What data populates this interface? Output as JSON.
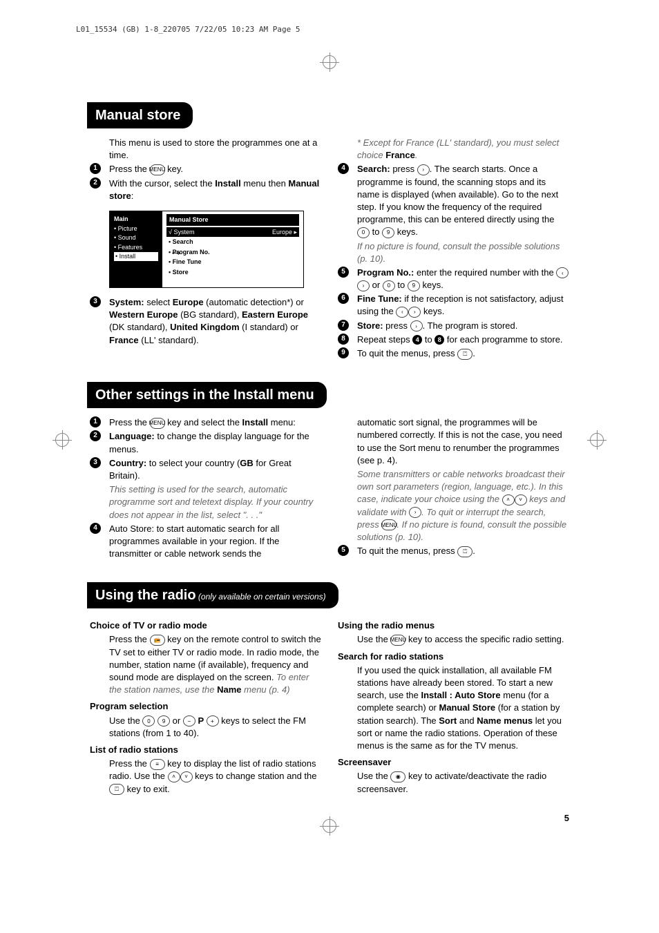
{
  "print_header": "L01_15534 (GB) 1-8_220705  7/22/05  10:23 AM  Page 5",
  "manual_store": {
    "title": "Manual store",
    "intro": "This menu is used to store the programmes one at a time.",
    "step1": "Press the ",
    "step1_key": "MENU",
    "step1_end": " key.",
    "step2a": "With the cursor, select the ",
    "step2b": "Install",
    "step2c": " menu then ",
    "step2d": "Manual store",
    "step2e": ":",
    "menu": {
      "title": "Main",
      "items": [
        "• Picture",
        "• Sound",
        "• Features"
      ],
      "sel_item": "• Install",
      "panel_title": "Manual Store",
      "panel_sel_left": "√ System",
      "panel_sel_right": "Europe ▸",
      "panel_items": [
        "• Search",
        "• Program No.",
        "• Fine Tune",
        "• Store"
      ]
    },
    "step3a": "System:",
    "step3b": " select ",
    "step3c": "Europe",
    "step3d": " (automatic detection*) or ",
    "step3e": "Western Europe",
    "step3f": " (BG standard), ",
    "step3g": "Eastern Europe",
    "step3h": " (DK standard), ",
    "step3i": "United Kingdom",
    "step3j": " (I standard) or ",
    "step3k": "France",
    "step3l": " (LL' standard).",
    "note_star": "* Except for France (LL' standard), you must select choice ",
    "note_star_b": "France",
    "note_star_end": ".",
    "step4a": "Search:",
    "step4b": " press ",
    "step4c": ". The search starts. Once a programme is found, the scanning stops and its name is displayed (when available). Go to the next step. If you know the frequency of the required programme, this can be entered directly using the ",
    "step4d": " to ",
    "step4e": " keys.",
    "step4_note": "If no picture is found, consult the possible solutions (p. 10).",
    "step5a": "Program No.:",
    "step5b": " enter the required number with the ",
    "step5c": " or ",
    "step5d": " to ",
    "step5e": " keys.",
    "step6a": "Fine Tune:",
    "step6b": " if the reception is not satisfactory, adjust using the ",
    "step6c": " keys.",
    "step7a": "Store:",
    "step7b": " press ",
    "step7c": ". The program is stored.",
    "step8a": "Repeat steps ",
    "step8b": " to ",
    "step8c": " for each programme to store.",
    "step9a": "To quit the menus, press ",
    "step9b": "."
  },
  "other_settings": {
    "title": "Other settings in the Install menu",
    "step1a": "Press the ",
    "step1b": " key and select the ",
    "step1c": "Install",
    "step1d": " menu:",
    "step2a": "Language:",
    "step2b": " to change the display language for the menus.",
    "step3a": "Country:",
    "step3b": " to select your country (",
    "step3c": "GB",
    "step3d": " for Great Britain).",
    "step3_note": "This setting is used for the search, automatic programme sort and teletext display. If your country does not appear in the list, select \". . .\"",
    "step4a": "Auto Store: to start automatic search for all programmes available in your region. If the transmitter or cable network sends the",
    "right1": "automatic sort signal, the programmes will be numbered correctly. If this is not the case, you need to use the Sort menu to renumber the programmes (see p. 4).",
    "right_note1": "Some transmitters or cable networks broadcast their own sort parameters (region, language, etc.). In this case, indicate your choice using the ",
    "right_note2": " keys and validate with ",
    "right_note3": ". To quit or interrupt the search, press ",
    "right_note4": ". If no picture is found, consult the possible solutions (p. 10).",
    "step5a": "To quit the menus, press ",
    "step5b": "."
  },
  "radio": {
    "title_main": "Using the radio",
    "title_sub": " (only available on certain versions)",
    "choice_hdr": "Choice of TV or radio mode",
    "choice_txt1": "Press the ",
    "choice_txt2": " key on the remote control to switch the TV set to either TV or radio mode. In radio mode, the number, station name (if available), frequency and sound mode are displayed on the screen. ",
    "choice_note1": "To enter the station names, use the ",
    "choice_note_b": "Name",
    "choice_note2": " menu (p. 4)",
    "prog_hdr": "Program selection",
    "prog_txt1": "Use the ",
    "prog_txt2": " or ",
    "prog_txt3": " P ",
    "prog_txt4": " keys to select the FM stations (from 1 to 40).",
    "list_hdr": "List of radio stations",
    "list_txt1": "Press the ",
    "list_txt2": " key to display the list of radio stations radio. Use the ",
    "list_txt3": " keys to change station and the ",
    "list_txt4": " key to exit.",
    "using_hdr": "Using the radio menus",
    "using_txt1": "Use the ",
    "using_txt2": " key to access the specific radio setting.",
    "search_hdr": "Search for radio stations",
    "search_txt1": "If you used the quick installation, all available FM stations have already been stored. To start a new search, use the ",
    "search_b1": "Install : Auto Store",
    "search_txt2": " menu (for a complete search) or ",
    "search_b2": "Manual Store",
    "search_txt3": " (for a station by station search). The ",
    "search_b3": "Sort",
    "search_txt4": " and ",
    "search_b4": "Name menus",
    "search_txt5": " let you sort or name the radio stations. Operation of these menus is the same as for the TV menus.",
    "ss_hdr": "Screensaver",
    "ss_txt1": "Use the ",
    "ss_txt2": " key to activate/deactivate the radio screensaver."
  },
  "page_num": "5"
}
